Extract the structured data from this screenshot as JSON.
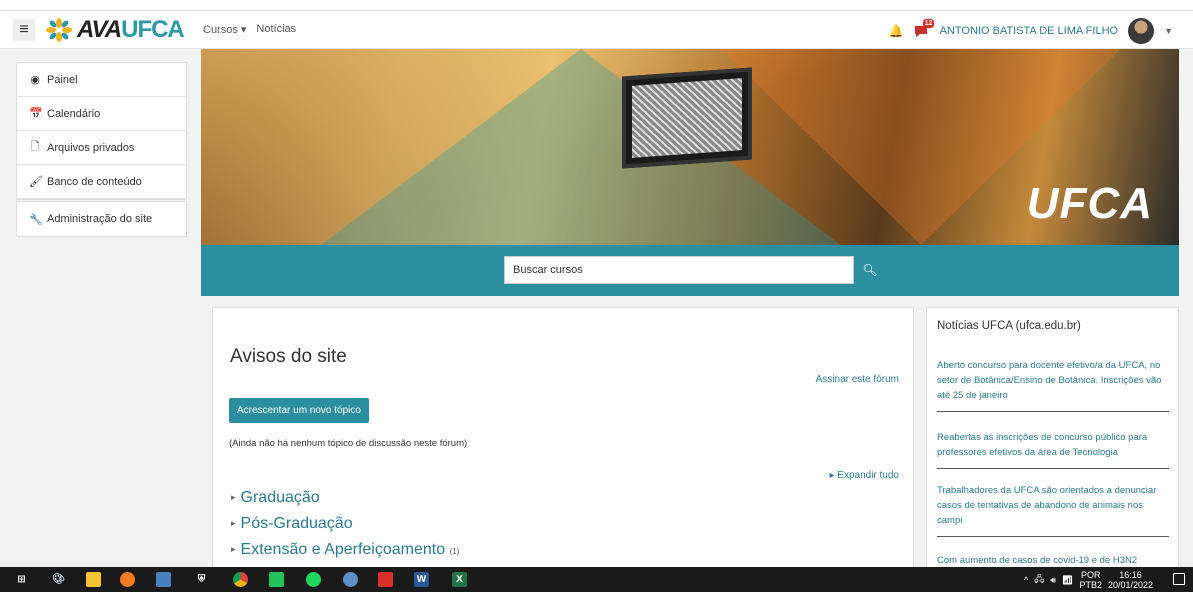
{
  "navbar": {
    "menu_icon": "hamburger-icon",
    "logo_ava": "AVA",
    "logo_ufca": "UFCA",
    "links": [
      "Cursos ▾",
      "Notícias"
    ],
    "notification_badge": "12",
    "username": "ANTONIO BATISTA DE LIMA FILHO"
  },
  "sidebar": {
    "items": [
      {
        "label": "Painel",
        "icon": "dashboard-icon"
      },
      {
        "label": "Calendário",
        "icon": "calendar-icon"
      },
      {
        "label": "Arquivos privados",
        "icon": "file-icon"
      },
      {
        "label": "Banco de conteúdo",
        "icon": "brush-icon"
      },
      {
        "label": "Administração do site",
        "icon": "wrench-icon"
      }
    ]
  },
  "banner": {
    "logo_text": "UFCA"
  },
  "search": {
    "placeholder": "Buscar cursos",
    "button_icon": "search-icon"
  },
  "forum": {
    "title": "Avisos do site",
    "subscribe": "Assinar este fórum",
    "add_topic": "Acrescentar um novo tópico",
    "empty": "(Ainda não há nenhum tópico de discussão neste fórum)",
    "expand_all": "Expandir tudo",
    "categories": [
      {
        "label": "Graduação",
        "count": ""
      },
      {
        "label": "Pós-Graduação",
        "count": ""
      },
      {
        "label": "Extensão e Aperfeiçoamento",
        "count": "(1)"
      }
    ]
  },
  "news": {
    "title": "Notícias UFCA (ufca.edu.br)",
    "items": [
      "Aberto concurso para docente efetivo/a da UFCA, no setor de Botânica/Ensino de Botânica. Inscrições vão até 25 de janeiro",
      "Reabertas as inscrições de concurso público para professores efetivos da área de Tecnologia",
      "Trabalhadores da UFCA são orientados a denunciar casos de tentativas de abandono de animais nos campi",
      "Com aumento de casos de covid-19 e de H3N2"
    ]
  },
  "taskbar": {
    "lang": "POR",
    "layout": "PTB2",
    "time": "16:16",
    "date": "20/01/2022"
  }
}
